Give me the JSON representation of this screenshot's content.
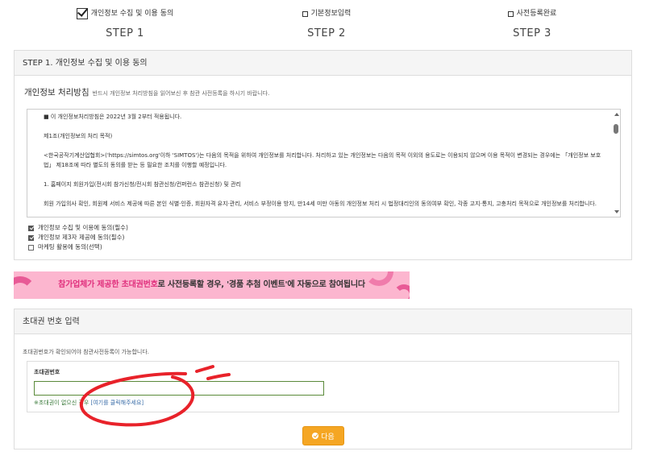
{
  "steps": [
    {
      "label": "개인정보 수집 및 이용 동의",
      "num": "STEP 1",
      "checked": true
    },
    {
      "label": "기본정보입력",
      "num": "STEP 2",
      "checked": false
    },
    {
      "label": "사전등록완료",
      "num": "STEP 3",
      "checked": false
    }
  ],
  "panel1": {
    "header": "STEP 1. 개인정보 수집 및 이용 동의",
    "policy_title": "개인정보 처리방침",
    "policy_note": "반드시 개인정보 처리방침을 읽어보신 후 참관 사전등록을 하시기 바랍니다.",
    "policy_paragraphs": [
      "■ 이 개인정보처리방침은 2022년 3월 2부터 적용됩니다.",
      "제1조(개인정보의 처리 목적)",
      "<한국공작기계산업협회>('https://simtos.org'이하 'SIMTOS')는 다음의 목적을 위하여 개인정보를 처리합니다. 처리하고 있는 개인정보는 다음의 목적 이외의 용도로는 이용되지 않으며 이용 목적이 변경되는 경우에는 「개인정보 보호법」 제18조에 따라 별도의 동의를 받는 등 필요한 조치를 이행할 예정입니다.",
      "1. 홈페이지 회원가입(전시회 참가신청/전시회 참관신청/컨퍼런스 참관신청) 및 관리",
      "회원 가입의사 확인, 회원제 서비스 제공에 따른 본인 식별·인증, 회원자격 유지·관리, 서비스 부정이용 방지, 만14세 미만 아동의 개인정보 처리 시 법정대리인의 동의여부 확인, 각종 고지·통지, 고충처리 목적으로 개인정보를 처리합니다."
    ],
    "consents": [
      {
        "label": "개인정보 수집 및 이용에 동의(필수)",
        "checked": true
      },
      {
        "label": "개인정보 제3자 제공에 동의(필수)",
        "checked": true
      },
      {
        "label": "마케팅 활용에 동의(선택)",
        "checked": false
      }
    ]
  },
  "banner": {
    "pink_text": "참가업체가 제공한 초대권번호",
    "rest_text": "로 사전등록할 경우, '경품 추첨 이벤트'에 자동으로 참여됩니다"
  },
  "panel2": {
    "header": "초대권 번호 입력",
    "desc": "초대권번호가 확인되어야 참관사전등록이 가능합니다.",
    "field_label": "초대권번호",
    "field_value": "",
    "hint_prefix": "※초대권이 없으신 경우",
    "hint_link": "[여기를 클릭해주세요]"
  },
  "next_button": "다음",
  "colors": {
    "accent": "#f5a623",
    "banner_bg": "#fcb6cf",
    "banner_pink": "#e0307d",
    "annotation_red": "#e8222a"
  }
}
